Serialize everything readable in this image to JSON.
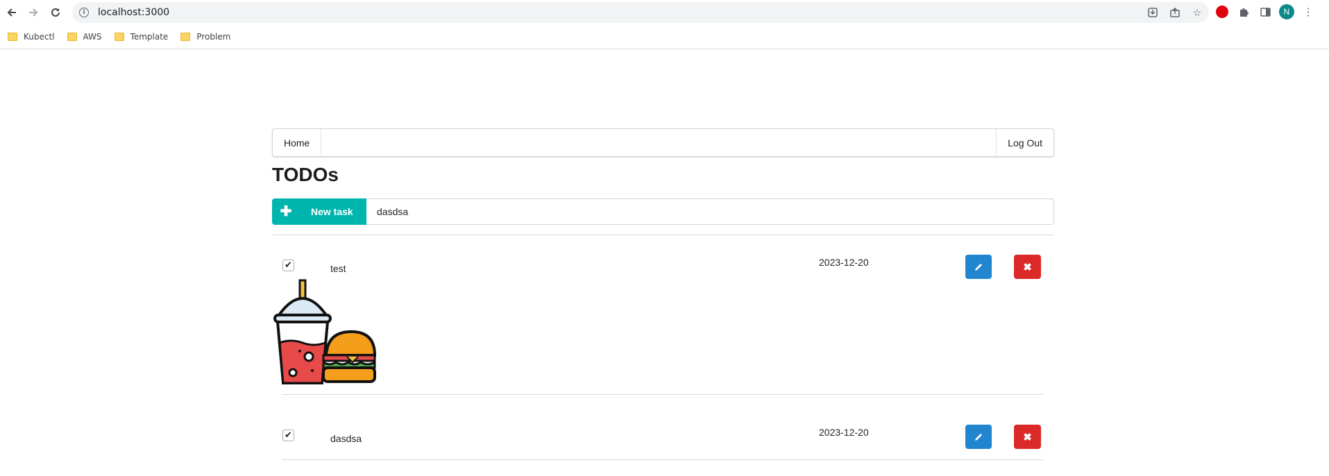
{
  "browser": {
    "url": "localhost:3000",
    "profile_initial": "N",
    "bookmarks": [
      {
        "label": "Kubectl"
      },
      {
        "label": "AWS"
      },
      {
        "label": "Template"
      },
      {
        "label": "Problem"
      }
    ]
  },
  "nav": {
    "home_label": "Home",
    "logout_label": "Log Out"
  },
  "page": {
    "title": "TODOs"
  },
  "new_task": {
    "button_label": "New task",
    "input_value": "dasdsa"
  },
  "tasks": [
    {
      "text": "test",
      "date": "2023-12-20",
      "checked": true,
      "image": "drink-and-burger-icon"
    },
    {
      "text": "dasdsa",
      "date": "2023-12-20",
      "checked": true
    }
  ],
  "colors": {
    "new_task_button": "#00b5ad",
    "edit_button": "#2185d0",
    "delete_button": "#db2828"
  }
}
